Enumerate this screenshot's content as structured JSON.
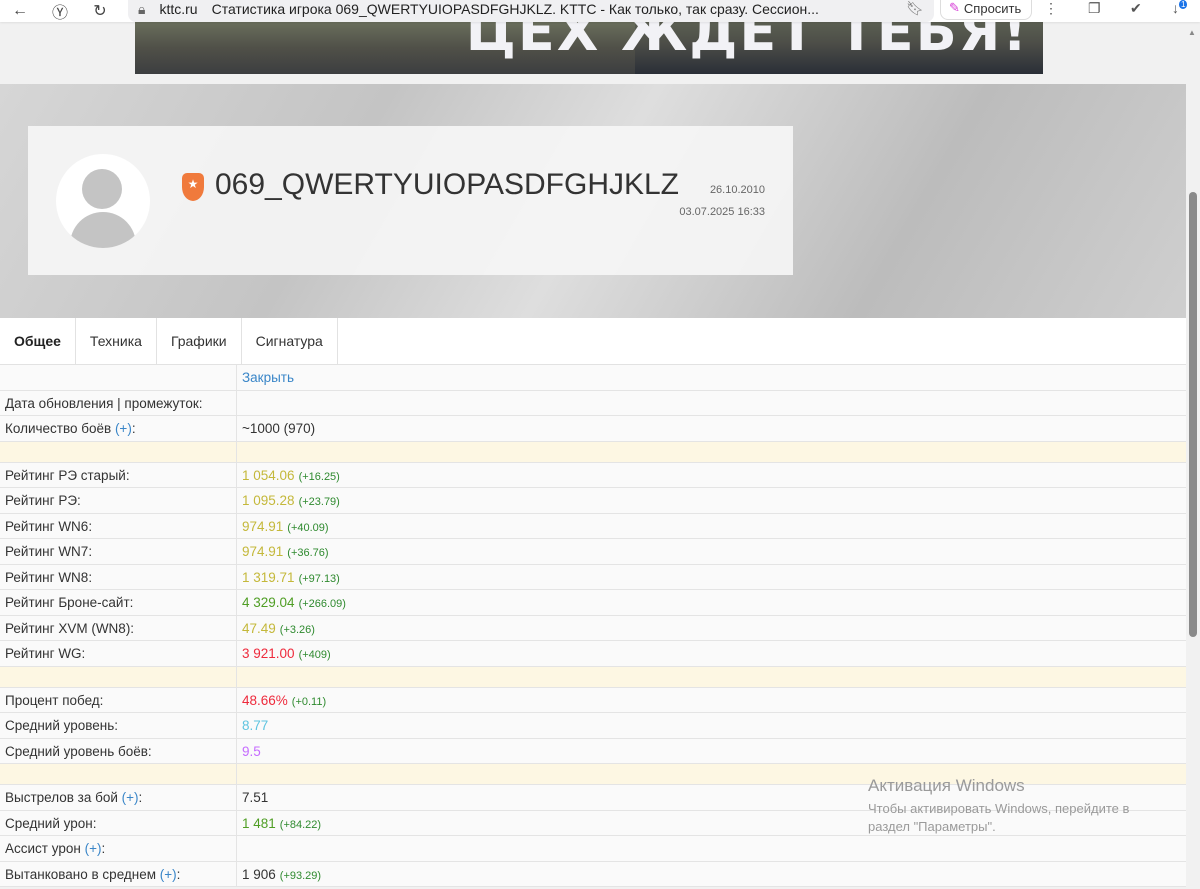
{
  "browser": {
    "domain": "kttc.ru",
    "tab_title": "Статистика игрока 069_QWERTYUIOPASDFGHJKLZ. KTTC - Как только, так сразу. Сессион...",
    "ask_label": "Спросить",
    "download_badge": "1"
  },
  "banner": {
    "text": "ЦЕХ ЖДЕТ ТЕБЯ!"
  },
  "profile": {
    "nickname": "069_QWERTYUIOPASDFGHJKLZ",
    "created": "26.10.2010",
    "updated": "03.07.2025 16:33"
  },
  "tabs": [
    "Общее",
    "Техника",
    "Графики",
    "Сигнатура"
  ],
  "close_label": "Закрыть",
  "colors": {
    "yellow": "#c4b83a",
    "green": "#4f9e24",
    "red": "#ee2a3c",
    "cyan": "#5ec4e0",
    "purple": "#c56cff",
    "default": "#333333"
  },
  "rows": [
    {
      "label": "Дата обновления | промежуток:",
      "value": "",
      "delta": ""
    },
    {
      "label": "Количество боёв",
      "plus": "(+)",
      "colon": ":",
      "value": "~1000 (970)",
      "delta": "",
      "color": "default"
    },
    {
      "sep": true
    },
    {
      "label": "Рейтинг РЭ старый:",
      "value": "1 054.06",
      "delta": "(+16.25)",
      "color": "yellow"
    },
    {
      "label": "Рейтинг РЭ:",
      "value": "1 095.28",
      "delta": "(+23.79)",
      "color": "yellow"
    },
    {
      "label": "Рейтинг WN6:",
      "value": "974.91",
      "delta": "(+40.09)",
      "color": "yellow"
    },
    {
      "label": "Рейтинг WN7:",
      "value": "974.91",
      "delta": "(+36.76)",
      "color": "yellow"
    },
    {
      "label": "Рейтинг WN8:",
      "value": "1 319.71",
      "delta": "(+97.13)",
      "color": "yellow"
    },
    {
      "label": "Рейтинг Броне-сайт:",
      "value": "4 329.04",
      "delta": "(+266.09)",
      "color": "green"
    },
    {
      "label": "Рейтинг XVM (WN8):",
      "value": "47.49",
      "delta": "(+3.26)",
      "color": "yellow"
    },
    {
      "label": "Рейтинг WG:",
      "value": "3 921.00",
      "delta": "(+409)",
      "color": "red"
    },
    {
      "sep": true
    },
    {
      "label": "Процент побед:",
      "value": "48.66%",
      "delta": "(+0.11)",
      "color": "red"
    },
    {
      "label": "Средний уровень:",
      "value": "8.77",
      "delta": "",
      "color": "cyan"
    },
    {
      "label": "Средний уровень боёв:",
      "value": "9.5",
      "delta": "",
      "color": "purple"
    },
    {
      "sep": true
    },
    {
      "label": "Выстрелов за бой",
      "plus": "(+)",
      "colon": ":",
      "value": "7.51",
      "delta": "",
      "color": "default"
    },
    {
      "label": "Средний урон:",
      "value": "1 481",
      "delta": "(+84.22)",
      "color": "green"
    },
    {
      "label": "Ассист урон",
      "plus": "(+)",
      "colon": ":",
      "value": "",
      "delta": ""
    },
    {
      "label": "Вытанковано в среднем",
      "plus": "(+)",
      "colon": ":",
      "value": "1 906",
      "delta": "(+93.29)",
      "color": "default"
    }
  ],
  "watermark": {
    "title": "Активация Windows",
    "text": "Чтобы активировать Windows, перейдите в раздел \"Параметры\"."
  }
}
